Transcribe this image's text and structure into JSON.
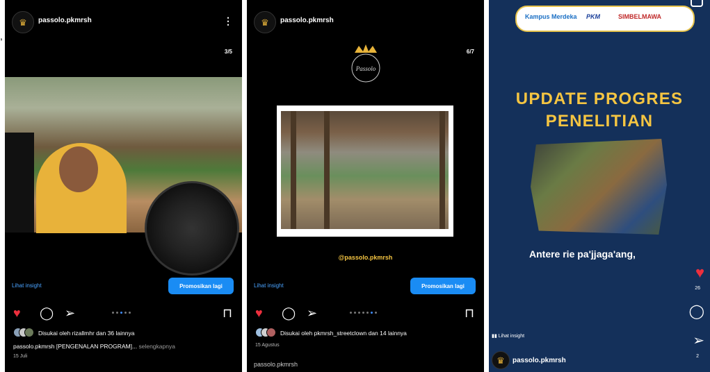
{
  "panel1": {
    "username": "passolo.pkmrsh",
    "counter": "3/5",
    "insight": "Lihat insight",
    "promote": "Promosikan lagi",
    "liked_by": "Disukai oleh rizallmhr dan 36 lainnya",
    "caption_user": "passolo.pkmrsh",
    "caption_text": "[PENGENALAN PROGRAM]...",
    "caption_more": "selengkapnya",
    "date": "15 Juli",
    "icons": [
      "heart-icon",
      "comment-icon",
      "send-icon",
      "bookmark-icon"
    ]
  },
  "panel2": {
    "username": "passolo.pkmrsh",
    "counter": "6/7",
    "logo_text": "Passolo",
    "handle": "@passolo.pkmrsh",
    "insight": "Lihat insight",
    "promote": "Promosikan lagi",
    "liked_by": "Disukai oleh pkmrsh_streetclown dan 14 lainnya",
    "date": "15 Agustus",
    "next_username": "passolo.pkmrsh"
  },
  "panel3": {
    "banner_items": [
      "Kampus Merdeka",
      "PKM",
      "SIMBELMAWA"
    ],
    "title_line1": "UPDATE PROGRES",
    "title_line2": "PENELITIAN",
    "subtitle": "Antere rie pa'jjaga'ang,",
    "likes": "26",
    "shares": "2",
    "insight": "Lihat insight",
    "username": "passolo.pkmrsh"
  },
  "colors": {
    "accent_blue": "#1a8cf4",
    "heart_red": "#ed2f3d",
    "gold": "#f5c542"
  }
}
